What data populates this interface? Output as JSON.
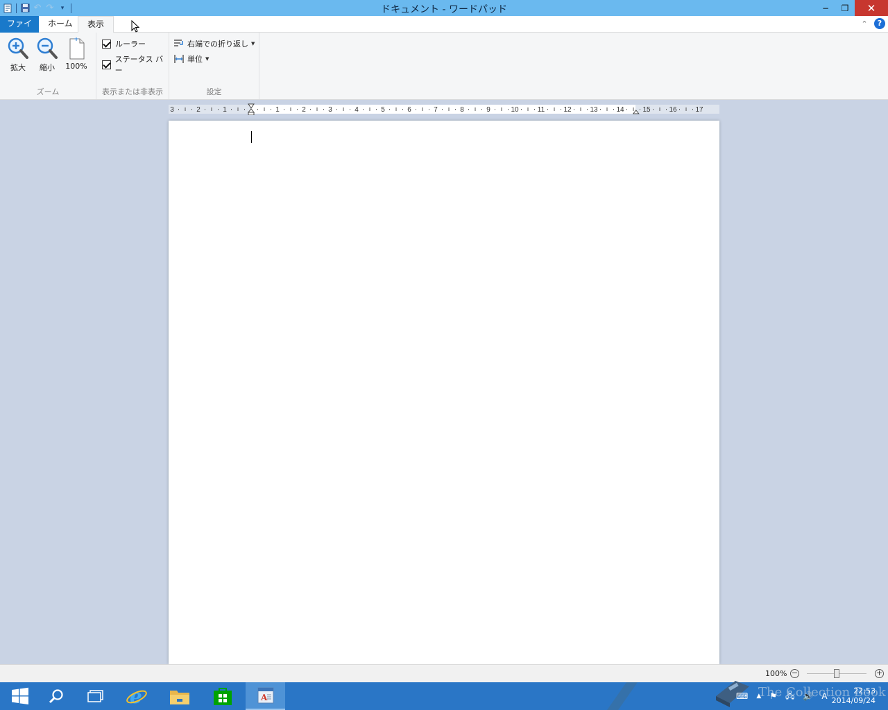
{
  "window": {
    "title": "ドキュメント - ワードパッド",
    "controls": {
      "minimize": "−",
      "restore": "❐",
      "close": "✕"
    }
  },
  "quick_access": {
    "icons": [
      "wordpad-app-icon",
      "save-icon",
      "undo-icon",
      "redo-icon",
      "customize-qat-icon"
    ]
  },
  "tabs": [
    {
      "label": "ファイル"
    },
    {
      "label": "ホーム"
    },
    {
      "label": "表示"
    }
  ],
  "active_tab": "表示",
  "ribbon": {
    "zoom": {
      "label": "ズーム",
      "zoom_in": "拡大",
      "zoom_out": "縮小",
      "hundred": "100%"
    },
    "show_hide": {
      "label": "表示または非表示",
      "ruler": {
        "label": "ルーラー",
        "checked": true
      },
      "status_bar": {
        "label": "ステータス バー",
        "checked": true
      }
    },
    "settings": {
      "label": "設定",
      "word_wrap": "右端での折り返し",
      "units": "単位"
    }
  },
  "ruler": {
    "ticks": [
      "3",
      "2",
      "1",
      "1",
      "2",
      "3",
      "4",
      "5",
      "6",
      "7",
      "8",
      "9",
      "10",
      "11",
      "12",
      "13",
      "14",
      "15",
      "16",
      "17"
    ]
  },
  "status": {
    "zoom_level": "100%",
    "zoom_fraction": 0.5
  },
  "taskbar": {
    "items": [
      "start-button",
      "search-icon",
      "task-view-icon",
      "internet-explorer-icon",
      "file-explorer-icon",
      "store-icon",
      "wordpad-taskbar-icon"
    ],
    "clock_time": "22:53",
    "clock_date": "2014/09/24",
    "ime": "A",
    "watermark": "The Collection Book"
  },
  "colors": {
    "titlebar": "#6ab9ef",
    "file_tab": "#1979ca",
    "close_button": "#c7372f",
    "taskbar": "#2a76c6",
    "workspace": "#c9d3e4"
  }
}
